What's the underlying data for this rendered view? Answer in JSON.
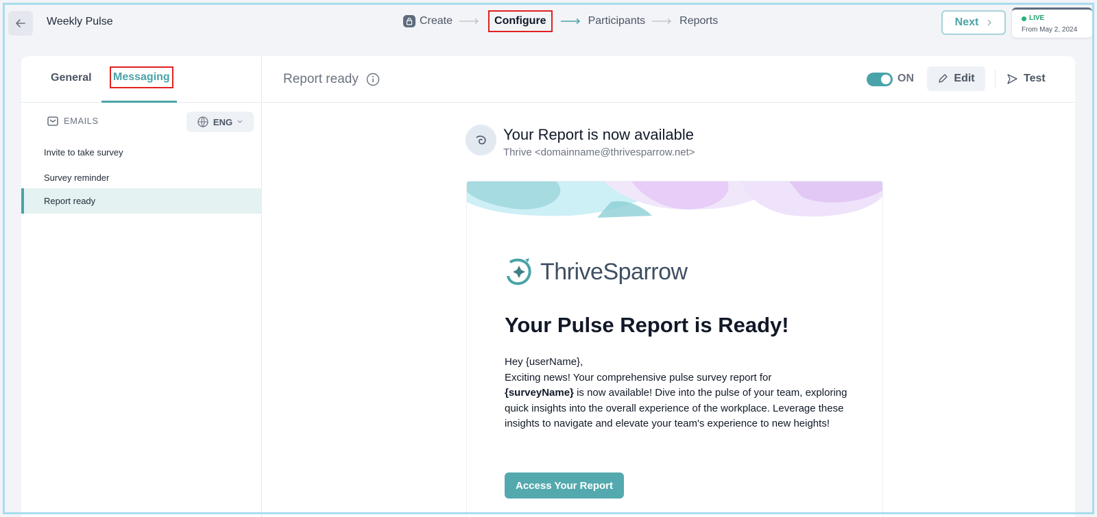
{
  "app": {
    "title": "Weekly Pulse",
    "back_icon": "arrow-left-icon"
  },
  "stepper": {
    "steps": [
      {
        "label": "Create",
        "icon": "lock-icon"
      },
      {
        "label": "Configure"
      },
      {
        "label": "Participants"
      },
      {
        "label": "Reports"
      }
    ],
    "active": "Configure"
  },
  "actions": {
    "next_label": "Next"
  },
  "status": {
    "label": "LIVE",
    "date": "From May 2, 2024",
    "color": "#22b573"
  },
  "left_panel": {
    "tabs": [
      {
        "label": "General"
      },
      {
        "label": "Messaging"
      }
    ],
    "active_tab": "Messaging",
    "emails_heading": "EMAILS",
    "language": "ENG",
    "emails": [
      {
        "label": "Invite to take survey"
      },
      {
        "label": "Survey reminder"
      },
      {
        "label": "Report ready"
      }
    ],
    "active_email": "Report ready"
  },
  "right_panel": {
    "title": "Report ready",
    "toggle_label": "ON",
    "toggle_on": true,
    "edit_label": "Edit",
    "test_label": "Test"
  },
  "email": {
    "subject": "Your Report is now available",
    "from": "Thrive <domainname@thrivesparrow.net>",
    "brand": "ThriveSparrow",
    "headline": "Your Pulse Report is Ready!",
    "greeting": "Hey {userName},",
    "line1": "Exciting news! Your comprehensive pulse survey report for",
    "survey_var": "{surveyName}",
    "line2": "is now available! Dive into the pulse of your team, exploring quick insights into the overall experience of the workplace. Leverage these insights to navigate and elevate your team's experience to new heights!",
    "cta_label": "Access Your Report"
  },
  "colors": {
    "accent": "#4aa3a8",
    "highlight": "#e02020",
    "button": "#54a9ae"
  }
}
